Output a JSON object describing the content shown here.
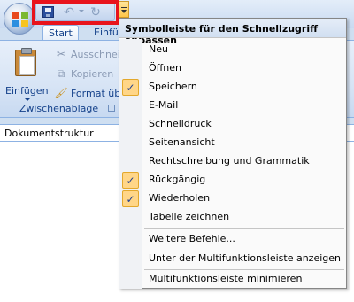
{
  "ribbon": {
    "tabs": [
      "Start",
      "Einfü"
    ],
    "clipboard": {
      "paste_label": "Einfügen",
      "cut_label": "Ausschnei",
      "copy_label": "Kopieren",
      "format_label": "Format übe",
      "group_label": "Zwischenablage"
    }
  },
  "doc_structure": "Dokumentstruktur",
  "menu": {
    "title": "Symbolleiste für den Schnellzugriff anpassen",
    "items": [
      {
        "label": "Neu",
        "checked": false
      },
      {
        "label": "Öffnen",
        "checked": false
      },
      {
        "label": "Speichern",
        "checked": true
      },
      {
        "label": "E-Mail",
        "checked": false
      },
      {
        "label": "Schnelldruck",
        "checked": false
      },
      {
        "label": "Seitenansicht",
        "checked": false
      },
      {
        "label": "Rechtschreibung und Grammatik",
        "checked": false
      },
      {
        "label": "Rückgängig",
        "checked": true
      },
      {
        "label": "Wiederholen",
        "checked": true
      },
      {
        "label": "Tabelle zeichnen",
        "checked": false
      }
    ],
    "more_commands": "Weitere Befehle...",
    "show_below": "Unter der Multifunktionsleiste anzeigen",
    "minimize": "Multifunktionsleiste minimieren"
  },
  "colors": {
    "highlight_border": "#e8141c",
    "check_background": "#ffd688"
  },
  "icons": [
    "office-logo-icon",
    "save-icon",
    "undo-icon",
    "redo-icon",
    "customize-dropdown-icon",
    "clipboard-icon",
    "scissors-icon",
    "copy-icon",
    "format-painter-icon",
    "checkmark-icon"
  ]
}
